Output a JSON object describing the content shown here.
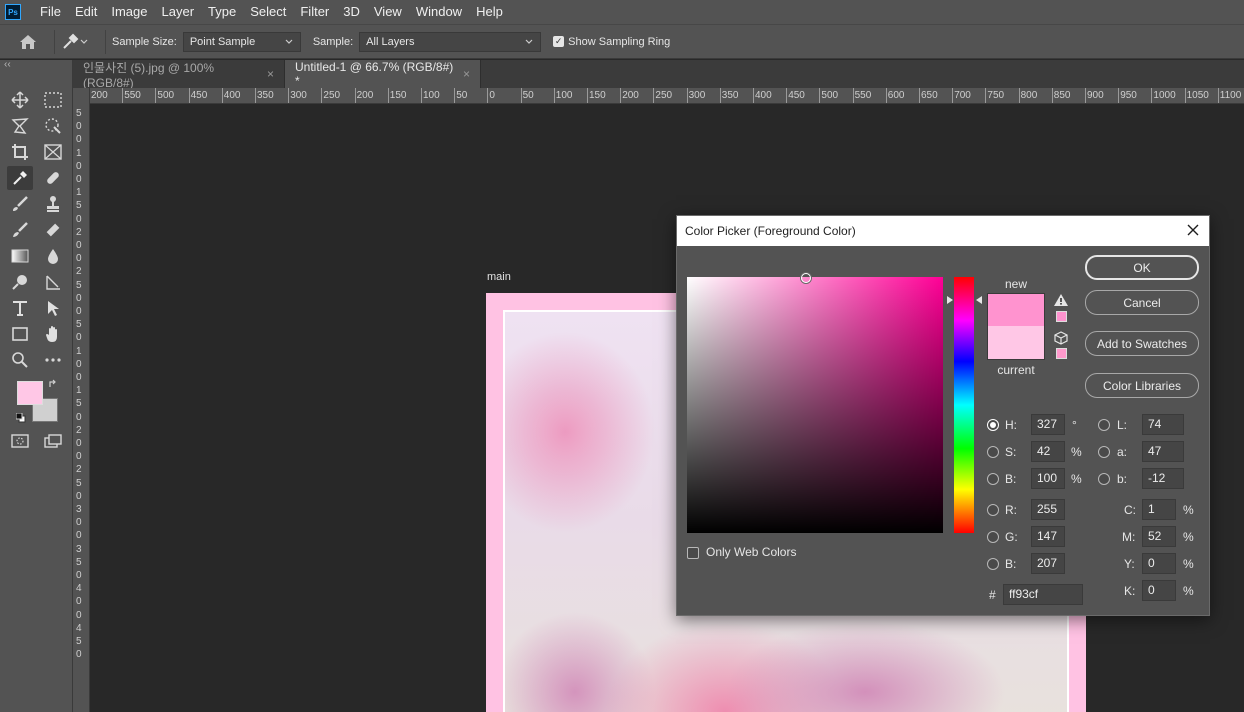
{
  "menubar": {
    "logo": "Ps",
    "items": [
      "File",
      "Edit",
      "Image",
      "Layer",
      "Type",
      "Select",
      "Filter",
      "3D",
      "View",
      "Window",
      "Help"
    ]
  },
  "options": {
    "sample_size_label": "Sample Size:",
    "sample_size_value": "Point Sample",
    "sample_label": "Sample:",
    "sample_value": "All Layers",
    "show_ring_label": "Show Sampling Ring",
    "show_ring_checked": true
  },
  "tabs": [
    {
      "label": "인물사진 (5).jpg @ 100% (RGB/8#)",
      "close": "×",
      "active": false
    },
    {
      "label": "Untitled-1 @ 66.7% (RGB/8#) *",
      "close": "×",
      "active": true
    }
  ],
  "toolbar": {
    "collapse": "‹‹"
  },
  "ruler_h": [
    "200",
    "550",
    "500",
    "450",
    "400",
    "350",
    "300",
    "250",
    "200",
    "150",
    "100",
    "50",
    "0",
    "50",
    "100",
    "150",
    "200",
    "250",
    "300",
    "350",
    "400",
    "450",
    "500",
    "550",
    "600",
    "650",
    "700",
    "750",
    "800",
    "850",
    "900",
    "950",
    "1000",
    "1050",
    "1100"
  ],
  "ruler_v": [
    "5",
    "0",
    "0",
    "1",
    "0",
    "0",
    "1",
    "5",
    "0",
    "2",
    "0",
    "0",
    "2",
    "5",
    "0",
    "0",
    "5",
    "0",
    "1",
    "0",
    "0",
    "1",
    "5",
    "0",
    "2",
    "0",
    "0",
    "2",
    "5",
    "0",
    "3",
    "0",
    "0",
    "3",
    "5",
    "0",
    "4",
    "0",
    "0",
    "4",
    "5",
    "0"
  ],
  "document": {
    "layer_name": "main"
  },
  "dialog": {
    "title": "Color Picker (Foreground Color)",
    "new_label": "new",
    "current_label": "current",
    "new_color": "#ff93cf",
    "current_color": "#ffc7e6",
    "buttons": {
      "ok": "OK",
      "cancel": "Cancel",
      "add_swatches": "Add to Swatches",
      "color_libraries": "Color Libraries"
    },
    "hsb": {
      "h_label": "H:",
      "h": "327",
      "h_unit": "°",
      "s_label": "S:",
      "s": "42",
      "s_unit": "%",
      "b_label": "B:",
      "b": "100",
      "b_unit": "%"
    },
    "lab": {
      "l_label": "L:",
      "l": "74",
      "a_label": "a:",
      "a": "47",
      "b_label": "b:",
      "b": "-12"
    },
    "rgb": {
      "r_label": "R:",
      "r": "255",
      "g_label": "G:",
      "g": "147",
      "b_label": "B:",
      "b": "207"
    },
    "cmyk": {
      "c_label": "C:",
      "c": "1",
      "m_label": "M:",
      "m": "52",
      "y_label": "Y:",
      "y": "0",
      "k_label": "K:",
      "k": "0",
      "unit": "%"
    },
    "hex_label": "#",
    "hex": "ff93cf",
    "only_web_colors": "Only Web Colors",
    "selected_channel": "H"
  }
}
